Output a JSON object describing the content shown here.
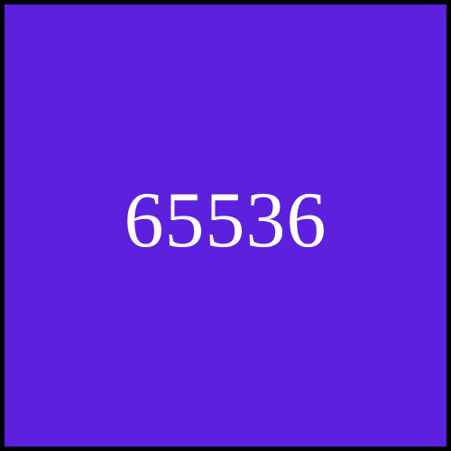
{
  "tile": {
    "value": "65536",
    "background_color": "#5d20dd",
    "border_color": "#000000",
    "text_color": "#ffffff"
  }
}
